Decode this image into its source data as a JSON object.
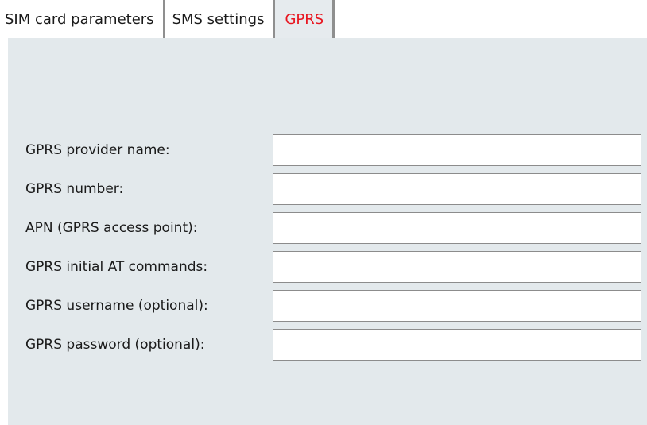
{
  "tabs": [
    {
      "label": "SIM card parameters",
      "active": false
    },
    {
      "label": "SMS settings",
      "active": false
    },
    {
      "label": "GPRS",
      "active": true
    }
  ],
  "colors": {
    "active_tab_text": "#e8141e",
    "panel_background": "#e3e9ec",
    "tab_separator": "#8f8f8f"
  },
  "form": {
    "fields": [
      {
        "label": "GPRS provider name:",
        "value": ""
      },
      {
        "label": "GPRS number:",
        "value": ""
      },
      {
        "label": "APN (GPRS access point):",
        "value": ""
      },
      {
        "label": "GPRS initial AT commands:",
        "value": ""
      },
      {
        "label": "GPRS username (optional):",
        "value": ""
      },
      {
        "label": "GPRS password (optional):",
        "value": ""
      }
    ]
  }
}
